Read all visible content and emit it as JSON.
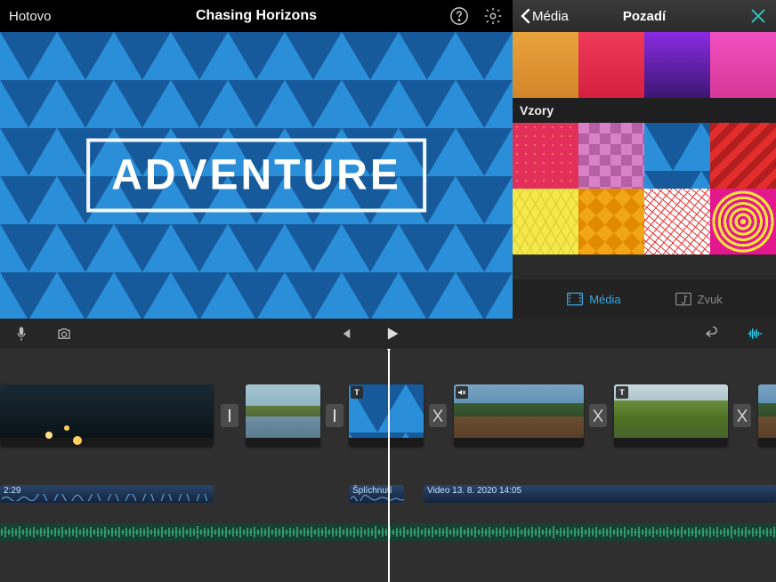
{
  "header": {
    "done_label": "Hotovo",
    "project_title": "Chasing Horizons"
  },
  "preview": {
    "title_text": "ADVENTURE"
  },
  "side_panel": {
    "back_label": "Média",
    "panel_title": "Pozadí",
    "section_patterns_label": "Vzory",
    "tabs": {
      "media": "Média",
      "audio": "Zvuk"
    },
    "gradient_swatches": [
      "orange",
      "red",
      "purple",
      "pink"
    ],
    "pattern_swatches": [
      "red-dots",
      "pink-diamond",
      "blue-triangles",
      "red-chevron",
      "yellow-hatch",
      "orange-triangles",
      "white-scribble",
      "magenta-rings"
    ]
  },
  "toolbar": {
    "mic": "mic",
    "camera": "camera",
    "prev": "skip-back",
    "play": "play",
    "undo": "undo",
    "audio_tool": "waveform"
  },
  "timeline": {
    "audio1": {
      "label": "2:29"
    },
    "audio2": {
      "label": "Šplíchnutí"
    },
    "audio3": {
      "label": "Video 13. 8. 2020 14:05"
    }
  }
}
